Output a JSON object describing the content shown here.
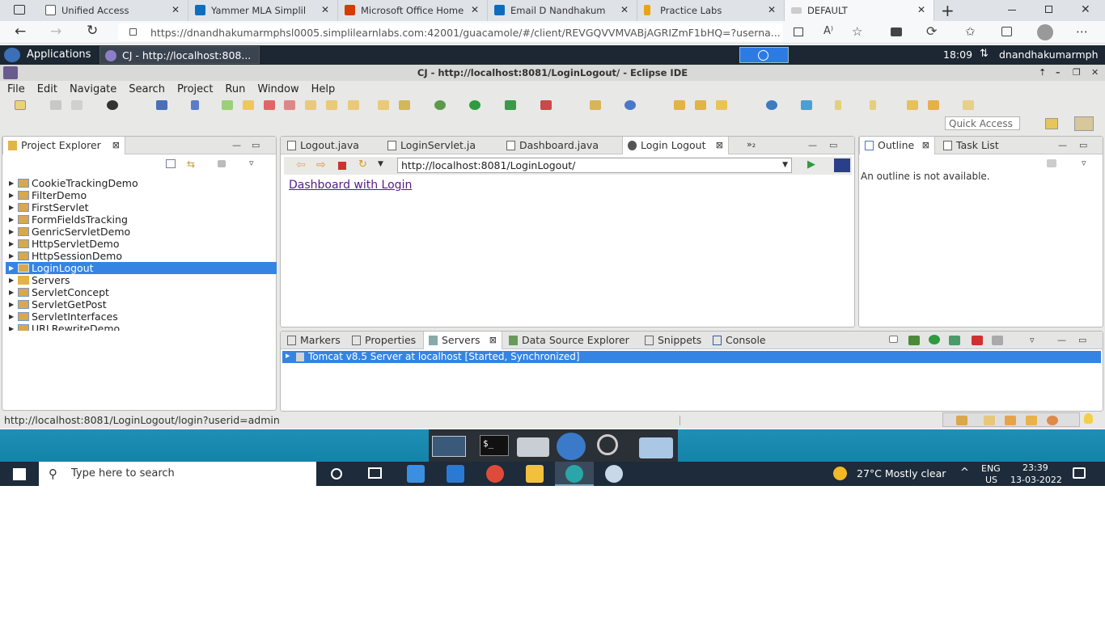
{
  "browser": {
    "tabs": [
      {
        "label": "Unified Access",
        "fav_color": "#555"
      },
      {
        "label": "Yammer   MLA Simplil",
        "fav_color": "#106ebe"
      },
      {
        "label": "Microsoft Office Home",
        "fav_color": "#d83b01"
      },
      {
        "label": "Email   D Nandhakum",
        "fav_color": "#0f6cbd"
      },
      {
        "label": "Practice Labs",
        "fav_color": "#e8a317"
      },
      {
        "label": "DEFAULT",
        "fav_color": "#cccccc"
      }
    ],
    "new_tab": "+",
    "url": "https://dnandhakumarmphsl0005.simplilearnlabs.com:42001/guacamole/#/client/REVGQVVMVABjAGRIZmF1bHQ=?userna..."
  },
  "remote_panel": {
    "applications": "Applications",
    "task": "CJ - http://localhost:808...",
    "time": "18:09",
    "user": "dnandhakumarmph"
  },
  "eclipse": {
    "title": "CJ - http://localhost:8081/LoginLogout/ - Eclipse IDE",
    "menu": [
      "File",
      "Edit",
      "Navigate",
      "Search",
      "Project",
      "Run",
      "Window",
      "Help"
    ],
    "quick_access": "Quick Access",
    "project_explorer": {
      "tab": "Project Explorer",
      "items": [
        {
          "label": "CookieTrackingDemo"
        },
        {
          "label": "FilterDemo"
        },
        {
          "label": "FirstServlet"
        },
        {
          "label": "FormFieldsTracking"
        },
        {
          "label": "GenricServletDemo"
        },
        {
          "label": "HttpServletDemo"
        },
        {
          "label": "HttpSessionDemo"
        },
        {
          "label": "LoginLogout"
        },
        {
          "label": "Servers"
        },
        {
          "label": "ServletConcept"
        },
        {
          "label": "ServletGetPost"
        },
        {
          "label": "ServletInterfaces"
        },
        {
          "label": "URLRewriteDemo"
        }
      ]
    },
    "editor": {
      "tabs": [
        "Logout.java",
        "LoginServlet.ja",
        "Dashboard.java",
        "Login Logout"
      ],
      "overflow": "»₂",
      "browser_url": "http://localhost:8081/LoginLogout/",
      "link": "Dashboard with Login"
    },
    "outline": {
      "tab": "Outline",
      "tab2": "Task List",
      "message": "An outline is not available."
    },
    "bottom": {
      "tabs": [
        "Markers",
        "Properties",
        "Servers",
        "Data Source Explorer",
        "Snippets",
        "Console"
      ],
      "server_row": "Tomcat v8.5 Server at localhost  [Started, Synchronized]"
    },
    "status": "http://localhost:8081/LoginLogout/login?userid=admin"
  },
  "taskbar": {
    "search_placeholder": "Type here to search",
    "weather": "27°C  Mostly clear",
    "lang": "ENG",
    "region": "US",
    "time": "23:39",
    "date": "13-03-2022"
  }
}
